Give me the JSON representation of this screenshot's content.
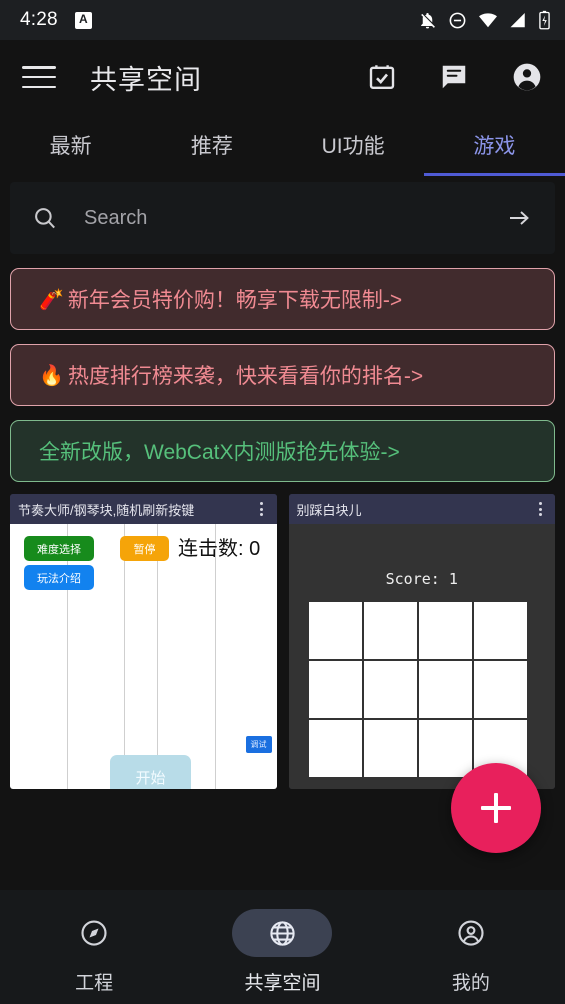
{
  "status_bar": {
    "time": "4:28",
    "app_badge": "A",
    "icons": [
      "bell-off-icon",
      "do-not-disturb-icon",
      "wifi-icon",
      "cellular-signal-icon",
      "battery-charging-icon"
    ]
  },
  "app_bar": {
    "menu_icon": "hamburger-menu-icon",
    "title": "共享空间",
    "actions": [
      {
        "icon": "calendar-check-icon",
        "name": "calendar-button"
      },
      {
        "icon": "chat-icon",
        "name": "chat-button"
      },
      {
        "icon": "account-circle-icon",
        "name": "account-button"
      }
    ]
  },
  "tabs": {
    "items": [
      {
        "label": "最新",
        "active": false
      },
      {
        "label": "推荐",
        "active": false
      },
      {
        "label": "UI功能",
        "active": false
      },
      {
        "label": "游戏",
        "active": true
      }
    ],
    "active_color": "#8b94e8",
    "indicator_color": "#4f5bd5"
  },
  "search": {
    "placeholder": "Search",
    "value": "",
    "search_icon": "search-icon",
    "submit_icon": "arrow-right-icon"
  },
  "banners": [
    {
      "emoji": "🧨",
      "text": "新年会员特价购！畅享下载无限制->",
      "style": "red",
      "border": "#e0a2aa",
      "bg": "#412b2d",
      "color": "#f08a92"
    },
    {
      "emoji": "🔥",
      "text": "热度排行榜来袭，快来看看你的排名->",
      "style": "red",
      "border": "#e0a2aa",
      "bg": "#412b2d",
      "color": "#f08a92"
    },
    {
      "emoji": "",
      "text": "全新改版，WebCatX内测版抢先体验->",
      "style": "green",
      "border": "#7fba8d",
      "bg": "#23332a",
      "color": "#56c07b"
    }
  ],
  "cards": [
    {
      "title": "节奏大师/钢琴块,随机刷新按键",
      "menu_icon": "more-vertical-icon",
      "preview": {
        "type": "piano-tiles",
        "buttons": [
          {
            "label": "难度选择",
            "color": "#178b1c"
          },
          {
            "label": "玩法介绍",
            "color": "#1282ef"
          },
          {
            "label": "暂停",
            "color": "#f5a409"
          }
        ],
        "combo_label": "连击数: 0",
        "start_label": "开始",
        "debug_label": "调试"
      }
    },
    {
      "title": "别踩白块儿",
      "menu_icon": "more-vertical-icon",
      "preview": {
        "type": "dont-tap-white-tile",
        "score_label": "Score: 1"
      }
    }
  ],
  "fab": {
    "icon": "plus-icon",
    "color": "#e8205c"
  },
  "bottom_nav": {
    "items": [
      {
        "label": "工程",
        "icon": "compass-icon",
        "active": false
      },
      {
        "label": "共享空间",
        "icon": "globe-icon",
        "active": true
      },
      {
        "label": "我的",
        "icon": "account-circle-icon",
        "active": false
      }
    ]
  }
}
